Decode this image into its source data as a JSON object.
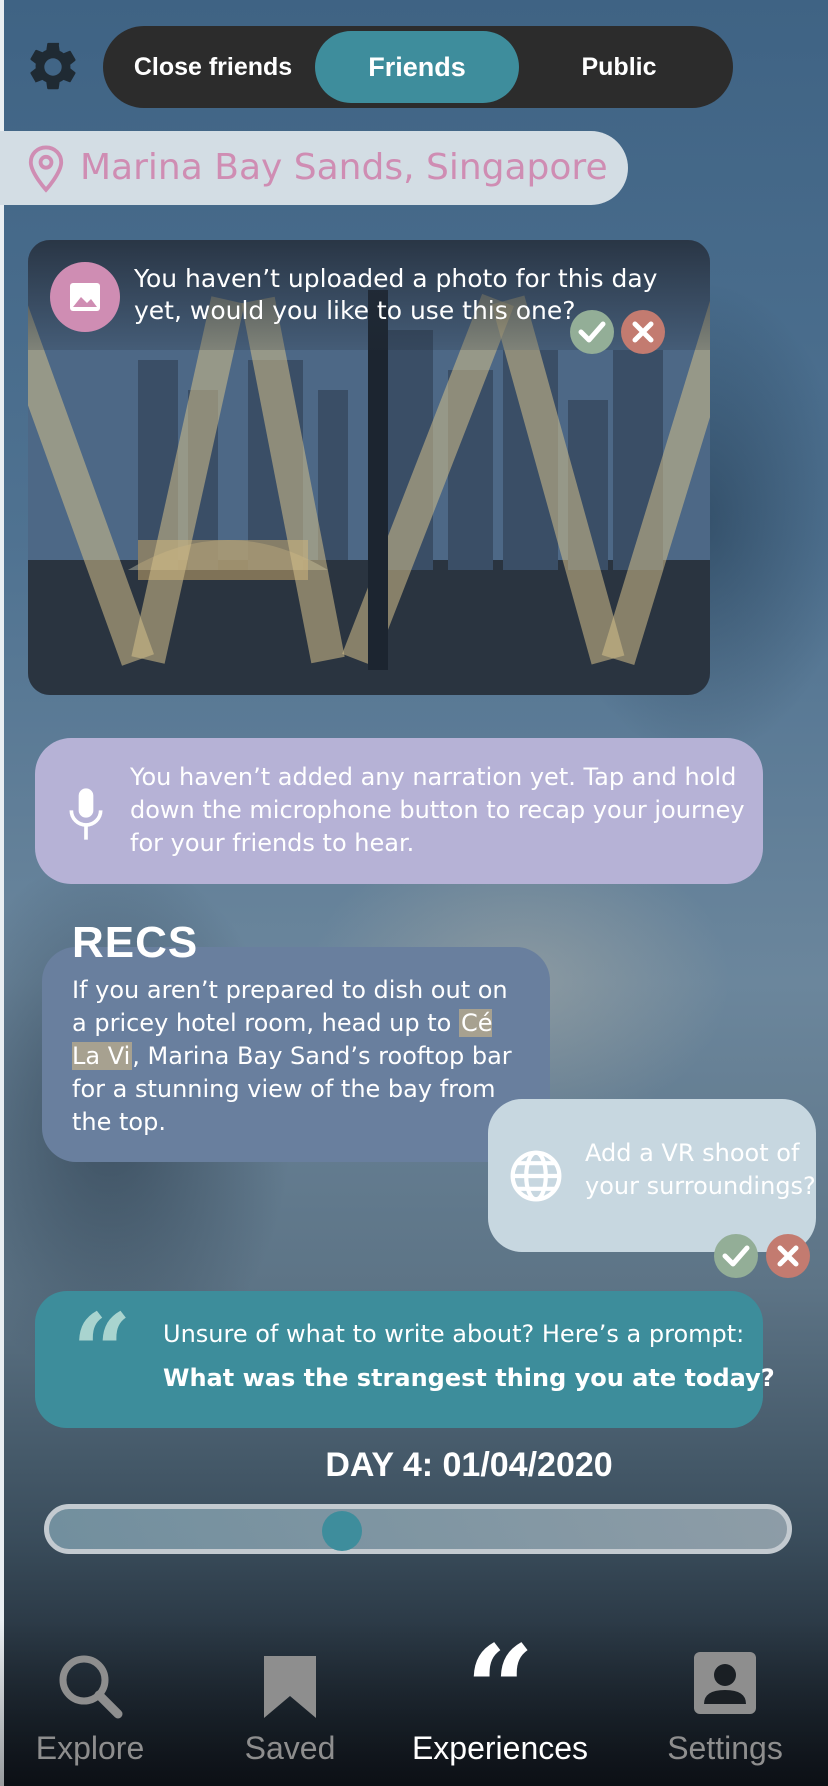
{
  "audience": {
    "options": [
      "Close friends",
      "Friends",
      "Public"
    ],
    "selected": "Friends"
  },
  "location": {
    "name": "Marina Bay Sands, Singapore"
  },
  "photo_prompt": {
    "text": "You haven’t uploaded a photo for this day yet, would you like to use this one?"
  },
  "narration": {
    "text": "You haven’t added any narration yet. Tap and hold down the microphone button to recap your journey for your friends to hear."
  },
  "recs": {
    "heading": "RECS",
    "text_before": "If you aren’t prepared to dish out on a pricey hotel room, head up to ",
    "highlight": "Cé La Vi",
    "text_after": ", Marina Bay Sand’s rooftop bar for a stunning view of the bay from the top."
  },
  "vr": {
    "text": "Add a VR shoot of your surroundings?"
  },
  "writing_prompt": {
    "intro": "Unsure of what to write about? Here’s a prompt:",
    "question": "What was the strangest thing you ate today?"
  },
  "day": {
    "label": "DAY 4: 01/04/2020",
    "slider_position": 0.39
  },
  "nav": {
    "items": [
      "Explore",
      "Saved",
      "Experiences",
      "Settings"
    ],
    "active": "Experiences"
  },
  "colors": {
    "accent_teal": "#3e8d9c",
    "pink": "#cf8db3",
    "narration_bg": "#b6b2d6",
    "confirm_green": "#93ae97",
    "reject_red": "#c37b70"
  }
}
